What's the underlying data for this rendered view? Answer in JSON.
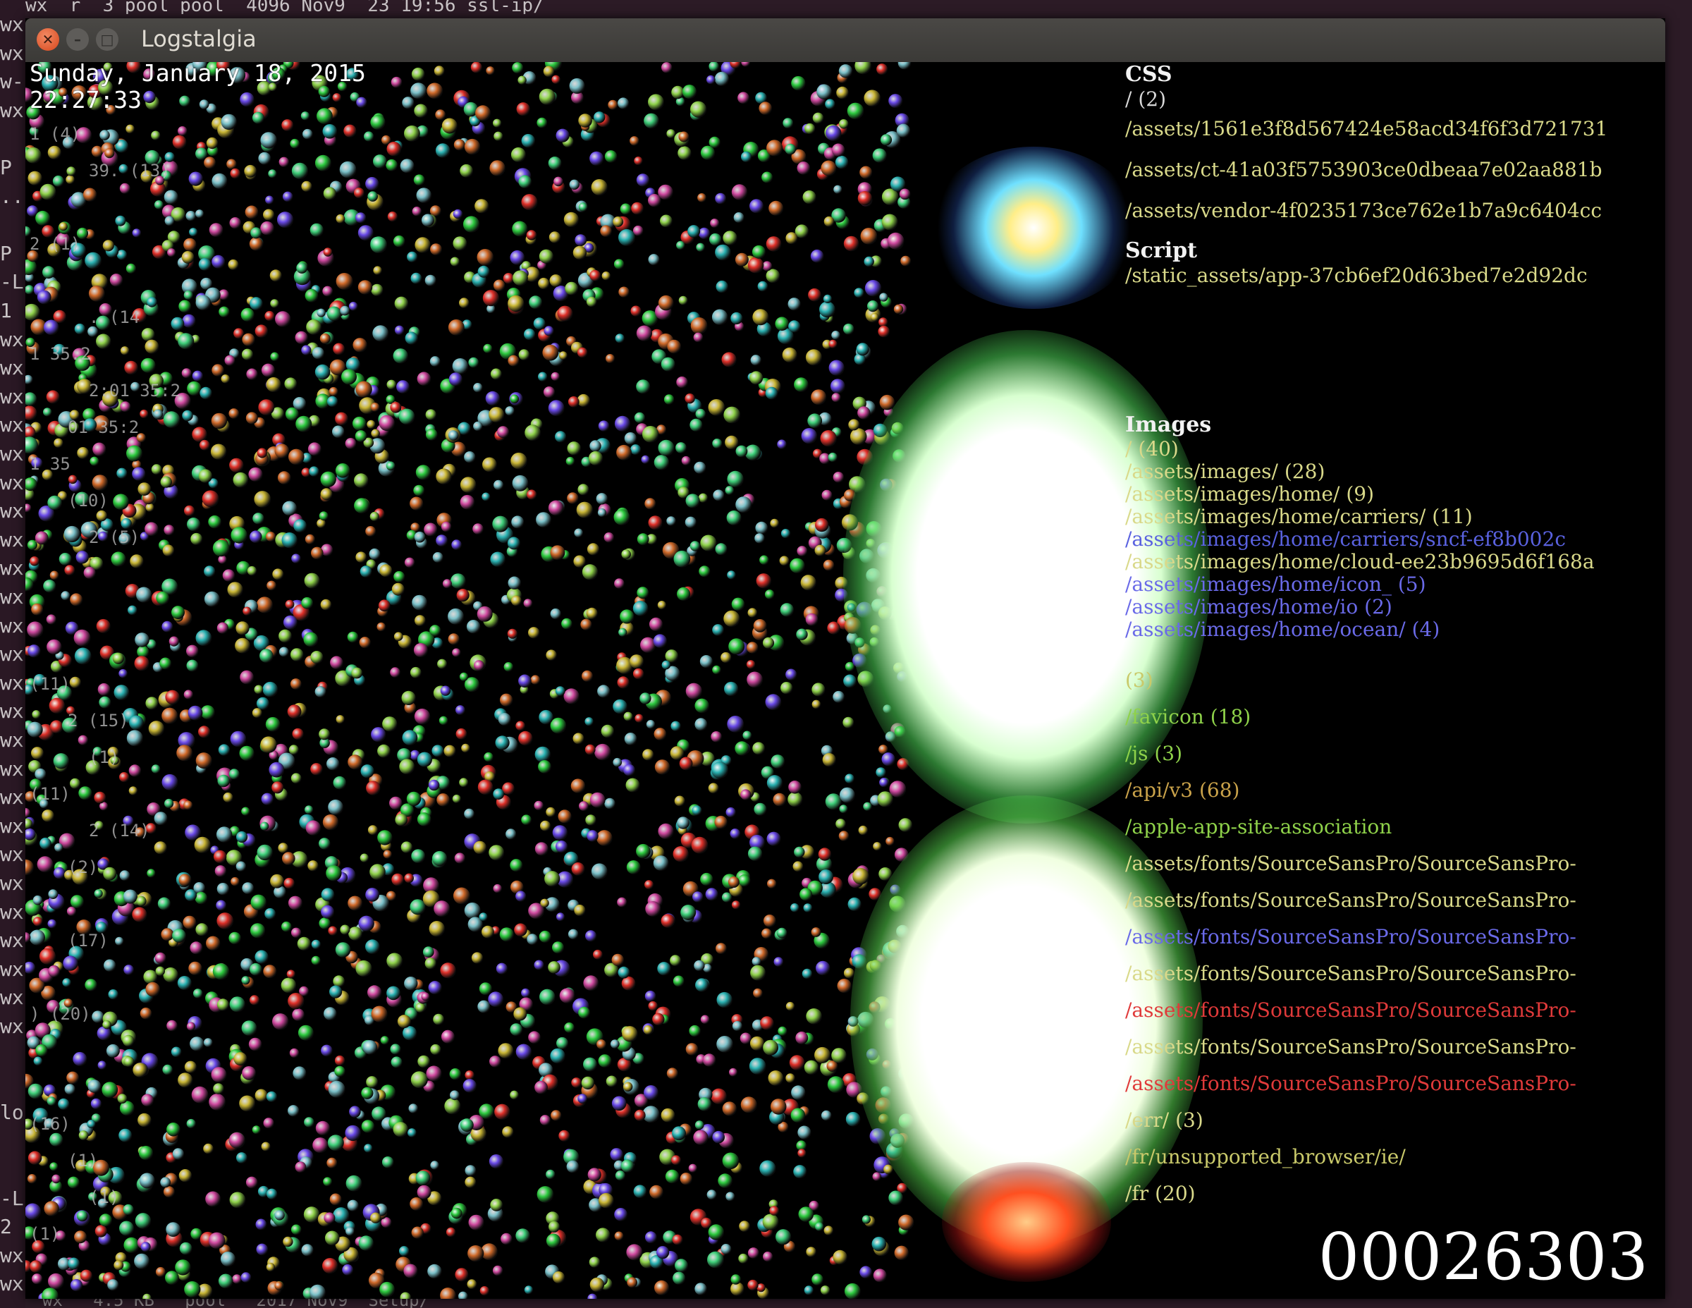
{
  "terminal": {
    "top_text": "wx  r  3 pool pool  4096 Nov9  23 19:56 ssl-ip/",
    "left_chars": [
      "wx",
      "wx",
      "w-",
      "wx",
      "",
      "P",
      "..",
      "",
      "P",
      "-L",
      "1",
      "wx",
      "wx",
      "wx",
      "wx",
      "wx",
      "wx",
      "wx",
      "wx",
      "wx",
      "wx",
      "wx",
      "wx",
      "wx",
      "wx",
      "wx",
      "wx",
      "wx",
      "wx",
      "wx",
      "wx",
      "wx",
      "wx",
      "wx",
      "wx",
      "wx",
      "",
      "",
      "lo",
      "",
      "",
      "-L",
      "2",
      "wx",
      "wx"
    ],
    "bottom_text": "wx   4.5 KB   pool   2017 Nov9  Setup/"
  },
  "window": {
    "title": "Logstalgia",
    "close_icon": "close-icon",
    "minimize_icon": "minimize-icon",
    "maximize_icon": "maximize-icon"
  },
  "hud": {
    "date": "Sunday, January 18, 2015",
    "time": "22:27:33",
    "counter": "00026303"
  },
  "left_hosts": [
    "1 (4)",
    "39. (13)",
    "",
    "2 (1)",
    "",
    ". (14",
    "1 35:2",
    "2:01 35:2",
    "01 35:2",
    "1 35",
    "(10)",
    "2 (5)",
    "",
    "",
    "",
    "(11)",
    "2 (15)",
    "(1)",
    "(11)",
    "2 (14)",
    "(2)",
    "",
    "(17)",
    "",
    ") (20)",
    "",
    "",
    "(16)",
    "(1)",
    "(1)",
    "(1)"
  ],
  "groups": [
    {
      "title": "CSS",
      "paths": [
        {
          "text": "/ (2)",
          "color": "#d8d8d8"
        },
        {
          "text": "/assets/1561e3f8d567424e58acd34f6f3d721731",
          "color": "#d9d98a"
        },
        {
          "text": "/assets/ct-41a03f5753903ce0dbeaa7e02aa881b",
          "color": "#d9d98a"
        },
        {
          "text": "/assets/vendor-4f0235173ce762e1b7a9c6404cc",
          "color": "#d9d98a"
        }
      ]
    },
    {
      "title": "Script",
      "paths": [
        {
          "text": "/static_assets/app-37cb6ef20d63bed7e2d92dc",
          "color": "#d9d98a"
        }
      ]
    },
    {
      "title": "Images",
      "paths": [
        {
          "text": "/ (40)",
          "color": "#d9d98a"
        },
        {
          "text": "/assets/images/ (28)",
          "color": "#d9d98a"
        },
        {
          "text": "/assets/images/home/ (9)",
          "color": "#d9d98a"
        },
        {
          "text": "/assets/images/home/carriers/ (11)",
          "color": "#d9d98a"
        },
        {
          "text": "/assets/images/home/carriers/sncf-ef8b002c",
          "color": "#5a62e0"
        },
        {
          "text": "/assets/images/home/cloud-ee23b9695d6f168a",
          "color": "#d9d98a"
        },
        {
          "text": "/assets/images/home/icon_ (5)",
          "color": "#6a6ae8"
        },
        {
          "text": "/assets/images/home/io (2)",
          "color": "#6a6ae8"
        },
        {
          "text": "/assets/images/home/ocean/ (4)",
          "color": "#6a6ae8"
        }
      ]
    },
    {
      "title": "",
      "paths": [
        {
          "text": "(3)",
          "color": "#c9c96a"
        },
        {
          "text": "/favicon (18)",
          "color": "#8fd24a"
        },
        {
          "text": "/js (3)",
          "color": "#8fd24a"
        },
        {
          "text": "/api/v3 (68)",
          "color": "#c9a24a"
        },
        {
          "text": "/apple-app-site-association",
          "color": "#8fd24a"
        },
        {
          "text": "/assets/fonts/SourceSansPro/SourceSansPro-",
          "color": "#d9d98a"
        },
        {
          "text": "/assets/fonts/SourceSansPro/SourceSansPro-",
          "color": "#d9d98a"
        },
        {
          "text": "/assets/fonts/SourceSansPro/SourceSansPro-",
          "color": "#6a6ae8"
        },
        {
          "text": "/assets/fonts/SourceSansPro/SourceSansPro-",
          "color": "#d9d98a"
        },
        {
          "text": "/assets/fonts/SourceSansPro/SourceSansPro-",
          "color": "#e03a3a"
        },
        {
          "text": "/assets/fonts/SourceSansPro/SourceSansPro-",
          "color": "#d9d98a"
        },
        {
          "text": "/assets/fonts/SourceSansPro/SourceSansPro-",
          "color": "#e03a3a"
        },
        {
          "text": "/err/ (3)",
          "color": "#d9d98a"
        },
        {
          "text": "/fr/unsupported_browser/ie/",
          "color": "#c9c96a"
        },
        {
          "text": "/fr (20)",
          "color": "#d9d98a"
        }
      ]
    }
  ],
  "colors": {
    "background": "#000000",
    "ball_colors": [
      "#2ecc40",
      "#3fd07a",
      "#e0312a",
      "#2bb3b3",
      "#c9b635",
      "#d06a2a",
      "#6a4ae8",
      "#d04aa0",
      "#8fd24a",
      "#7ac0c8"
    ]
  }
}
